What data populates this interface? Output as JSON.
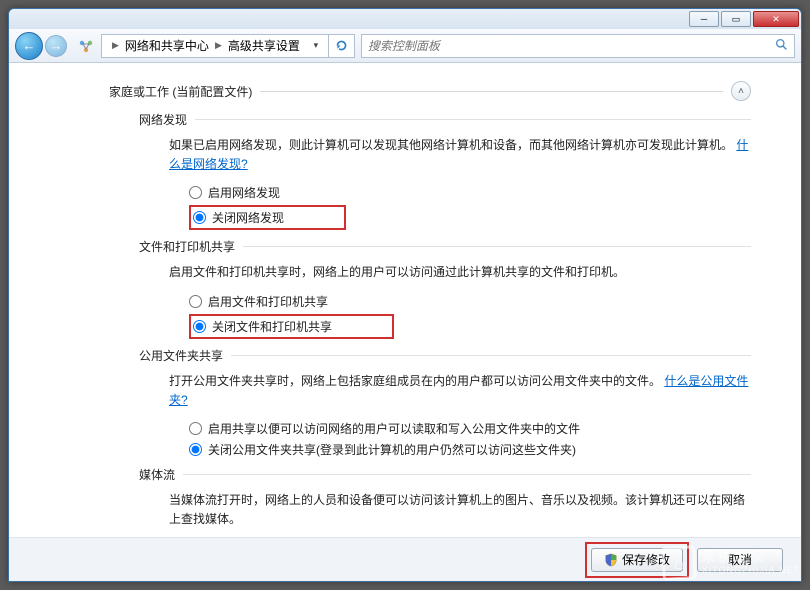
{
  "breadcrumb": {
    "part1": "网络和共享中心",
    "part2": "高级共享设置"
  },
  "search": {
    "placeholder": "搜索控制面板"
  },
  "profile": {
    "title": "家庭或工作  (当前配置文件)"
  },
  "sections": {
    "network_discovery": {
      "title": "网络发现",
      "desc_prefix": "如果已启用网络发现，则此计算机可以发现其他网络计算机和设备，而其他网络计算机亦可发现此计算机。",
      "link": "什么是网络发现?",
      "opt_on": "启用网络发现",
      "opt_off": "关闭网络发现"
    },
    "file_printer": {
      "title": "文件和打印机共享",
      "desc": "启用文件和打印机共享时，网络上的用户可以访问通过此计算机共享的文件和打印机。",
      "opt_on": "启用文件和打印机共享",
      "opt_off": "关闭文件和打印机共享"
    },
    "public_folder": {
      "title": "公用文件夹共享",
      "desc_prefix": "打开公用文件夹共享时，网络上包括家庭组成员在内的用户都可以访问公用文件夹中的文件。",
      "link": "什么是公用文件夹?",
      "opt_on": "启用共享以便可以访问网络的用户可以读取和写入公用文件夹中的文件",
      "opt_off": "关闭公用文件夹共享(登录到此计算机的用户仍然可以访问这些文件夹)"
    },
    "media_stream": {
      "title": "媒体流",
      "desc": "当媒体流打开时，网络上的人员和设备便可以访问该计算机上的图片、音乐以及视频。该计算机还可以在网络上查找媒体。"
    }
  },
  "buttons": {
    "save": "保存修改",
    "cancel": "取消"
  },
  "watermark": {
    "cn": "系统之家",
    "en": "XITONGZHIJIA.NET"
  }
}
